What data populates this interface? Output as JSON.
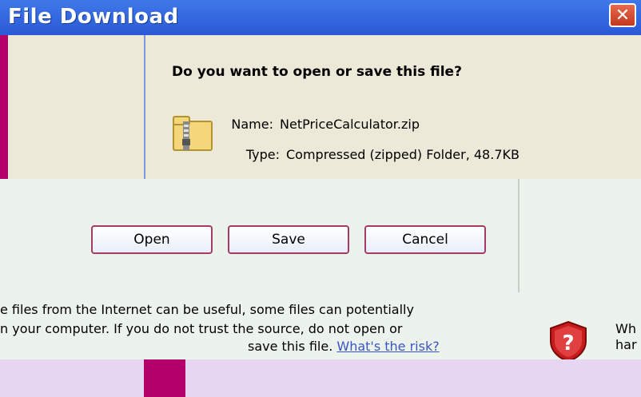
{
  "window": {
    "title": "File Download",
    "close_glyph": "✕"
  },
  "dialog": {
    "question": "Do you want to open or save this file?",
    "file": {
      "name_label": "Name:",
      "name_value": "NetPriceCalculator.zip",
      "type_label": "Type:",
      "type_value": "Compressed (zipped) Folder, 48.7KB"
    },
    "buttons": {
      "open": "Open",
      "save": "Save",
      "cancel": "Cancel"
    },
    "warning_line1": "e files from the Internet can be useful, some files can potentially",
    "warning_line2": "n your computer. If you do not trust the source, do not open or",
    "warning_line3": "save this file.",
    "risk_link": "What's the risk?",
    "side_warning_line1": "Wh",
    "side_warning_line2": "har"
  },
  "icons": {
    "file": "zip-folder-icon",
    "warning": "shield-question-icon",
    "close": "close-icon"
  },
  "colors": {
    "background": "#b3006b",
    "titlebar": "#3f78e8",
    "panel": "#ece9d8",
    "lower_panel": "#ecf2ec",
    "button_border": "#a33b65",
    "link": "#3a55c8",
    "shield": "#c81c1c"
  }
}
